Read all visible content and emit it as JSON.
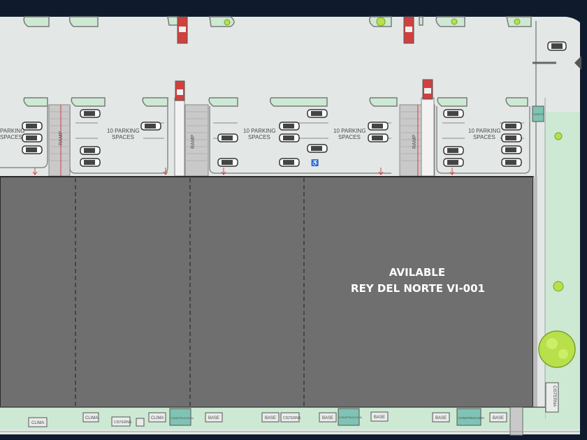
{
  "building": {
    "status": "AVILABLE",
    "name": "REY DEL NORTE VI-001"
  },
  "parking": {
    "label_line1": "10 PARKING",
    "label_line2": "SPACES",
    "partial_line1": "PARKING",
    "partial_line2": "SPACES"
  },
  "ramp_label": "RAMP",
  "caseta_label": "CASETA",
  "cisterna_label": "CISTERNA",
  "equipment": {
    "clima": "CLIMA",
    "cisterna": "CISTERNA",
    "construccion": "CONSTRUCCION",
    "base": "BASE"
  },
  "colors": {
    "ground": "#e3e8e6",
    "building": "#6f6f6f",
    "green_area": "#cde9d4",
    "teal_box": "#7fc3b4",
    "truck_red": "#d0403e",
    "frame": "#0f1b2d"
  }
}
